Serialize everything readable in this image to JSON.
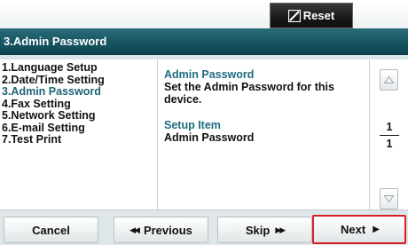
{
  "header": {
    "reset_label": "Reset",
    "reset_icon": "reset-icon"
  },
  "title": "3.Admin Password",
  "steps": [
    {
      "label": "1.Language Setup",
      "active": false
    },
    {
      "label": "2.Date/Time Setting",
      "active": false
    },
    {
      "label": "3.Admin Password",
      "active": true
    },
    {
      "label": "4.Fax Setting",
      "active": false
    },
    {
      "label": "5.Network Setting",
      "active": false
    },
    {
      "label": "6.E-mail Setting",
      "active": false
    },
    {
      "label": "7.Test Print",
      "active": false
    }
  ],
  "content": {
    "heading": "Admin Password",
    "description_line1": "Set the Admin Password for this",
    "description_line2": "device.",
    "setup_heading": "Setup Item",
    "setup_value": "Admin Password"
  },
  "pager": {
    "current": "1",
    "total": "1"
  },
  "buttons": {
    "cancel": "Cancel",
    "previous": "Previous",
    "skip": "Skip",
    "next": "Next"
  },
  "colors": {
    "title_bar": "#165360",
    "accent_text": "#1f6b7f",
    "next_highlight": "#d81f26"
  }
}
